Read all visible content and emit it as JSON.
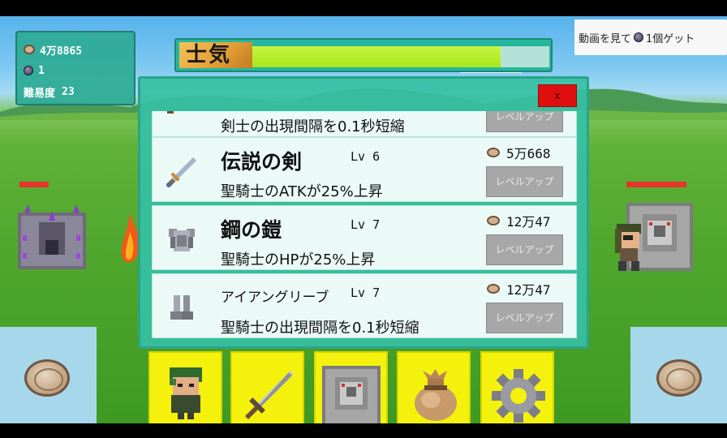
{
  "stats": {
    "coins": "4万8865",
    "gems": "1",
    "bonus_label": "難易度",
    "bonus_value": "23"
  },
  "morale": {
    "label": "士気",
    "fill_fraction": 0.84
  },
  "video_reward": {
    "label_before": "動画を見て",
    "label_after": "1個ゲット"
  },
  "close_label": "x",
  "upgrades": [
    {
      "name": "",
      "level": "",
      "description": "剣士の出現間隔を0.1秒短縮",
      "price": "",
      "button_label": "レベルアップ",
      "icon": "sword-icon"
    },
    {
      "name": "伝説の剣",
      "level": "Lv 6",
      "description": "聖騎士のATKが25%上昇",
      "price": "5万668",
      "button_label": "レベルアップ",
      "icon": "legendary-sword-icon"
    },
    {
      "name": "鋼の鎧",
      "level": "Lv 7",
      "description": "聖騎士のHPが25%上昇",
      "price": "12万47",
      "button_label": "レベルアップ",
      "icon": "steel-armor-icon"
    },
    {
      "name": "アイアングリーブ",
      "level": "Lv 7",
      "description": "聖騎士の出現間隔を0.1秒短縮",
      "price": "12万47",
      "button_label": "レベルアップ",
      "icon": "iron-greaves-icon"
    }
  ],
  "tabs": [
    "character-tab-icon",
    "sword-tab-icon",
    "castle-tab-icon",
    "bag-tab-icon",
    "gear-tab-icon"
  ],
  "colors": {
    "dialog": "#36c0a2",
    "morale_fill": "#b5ee2a",
    "tab": "#f4f20d",
    "close": "#e00f0f",
    "hp": "#e6352a"
  }
}
